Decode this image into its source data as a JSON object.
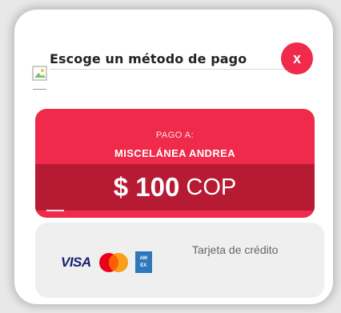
{
  "modal": {
    "title": "Escoge un método de pago",
    "close_label": "x"
  },
  "payment": {
    "pay_to_label": "PAGO A:",
    "merchant": "MISCELÁNEA ANDREA",
    "amount": "$ 100",
    "currency": "COP"
  },
  "methods": [
    {
      "brands": [
        "VISA",
        "Mastercard",
        "AMEX"
      ],
      "visa_text": "VISA",
      "amex_text_top": "AM",
      "amex_text_bottom": "EX",
      "label": "Tarjeta de crédito"
    }
  ],
  "colors": {
    "accent": "#ef2a4a",
    "accent_dark": "#b71a33",
    "method_bg": "#efefef"
  },
  "icons": {
    "close": "close-icon",
    "broken_image": "broken-image-icon"
  }
}
